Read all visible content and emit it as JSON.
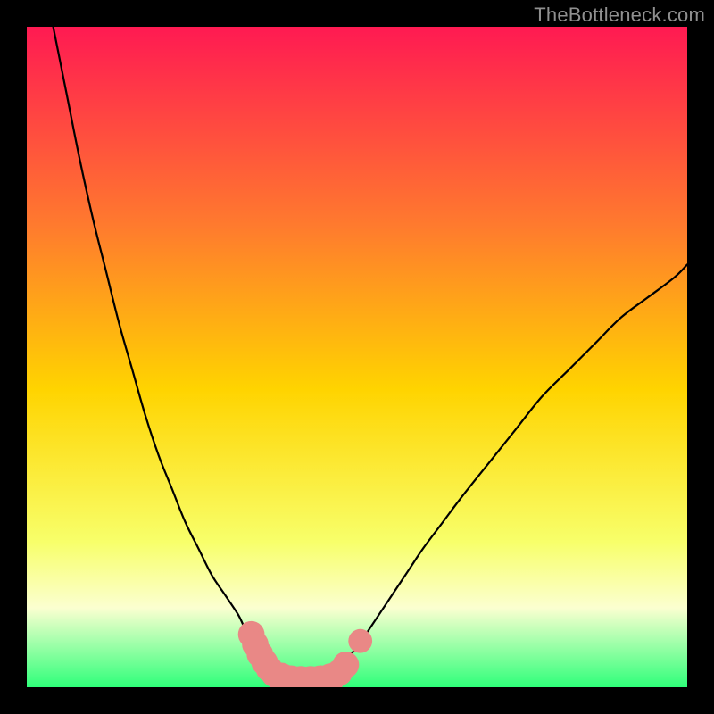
{
  "watermark": "TheBottleneck.com",
  "colors": {
    "frame": "#000000",
    "gradient_top": "#ff1a52",
    "gradient_mid_upper": "#ff7a2e",
    "gradient_mid": "#ffd400",
    "gradient_lower": "#f8ff6a",
    "gradient_band": "#fbffd0",
    "gradient_bottom": "#2fff7a",
    "curve": "#000000",
    "marker": "#e98886"
  },
  "chart_data": {
    "type": "line",
    "title": "",
    "xlabel": "",
    "ylabel": "",
    "xlim": [
      0,
      100
    ],
    "ylim": [
      0,
      100
    ],
    "grid": false,
    "series": [
      {
        "name": "left-curve",
        "x": [
          4,
          6,
          8,
          10,
          12,
          14,
          16,
          18,
          20,
          22,
          24,
          26,
          28,
          30,
          32,
          33,
          34,
          35,
          36,
          37,
          38,
          39,
          40
        ],
        "y": [
          100,
          90,
          80,
          71,
          63,
          55,
          48,
          41,
          35,
          30,
          25,
          21,
          17,
          14,
          11,
          9,
          8,
          6,
          5,
          4,
          3,
          2,
          1
        ]
      },
      {
        "name": "right-curve",
        "x": [
          46,
          47,
          48,
          50,
          52,
          54,
          56,
          58,
          60,
          63,
          66,
          70,
          74,
          78,
          82,
          86,
          90,
          94,
          98,
          100
        ],
        "y": [
          1,
          2,
          4,
          6,
          9,
          12,
          15,
          18,
          21,
          25,
          29,
          34,
          39,
          44,
          48,
          52,
          56,
          59,
          62,
          64
        ]
      }
    ],
    "markers": [
      {
        "x": 34.0,
        "y": 8.0,
        "r": 1.2
      },
      {
        "x": 34.6,
        "y": 6.5,
        "r": 1.2
      },
      {
        "x": 35.3,
        "y": 5.0,
        "r": 1.2
      },
      {
        "x": 36.0,
        "y": 3.8,
        "r": 1.2
      },
      {
        "x": 36.7,
        "y": 2.8,
        "r": 1.2
      },
      {
        "x": 37.5,
        "y": 2.0,
        "r": 1.2
      },
      {
        "x": 38.5,
        "y": 1.5,
        "r": 1.4
      },
      {
        "x": 40.0,
        "y": 1.0,
        "r": 1.5
      },
      {
        "x": 41.5,
        "y": 0.9,
        "r": 1.5
      },
      {
        "x": 43.0,
        "y": 0.9,
        "r": 1.5
      },
      {
        "x": 44.5,
        "y": 1.0,
        "r": 1.5
      },
      {
        "x": 46.0,
        "y": 1.4,
        "r": 1.4
      },
      {
        "x": 47.3,
        "y": 2.2,
        "r": 1.2
      },
      {
        "x": 48.3,
        "y": 3.4,
        "r": 1.2
      },
      {
        "x": 50.5,
        "y": 7.0,
        "r": 1.0
      }
    ],
    "valley_min_x": 43,
    "annotations": []
  }
}
